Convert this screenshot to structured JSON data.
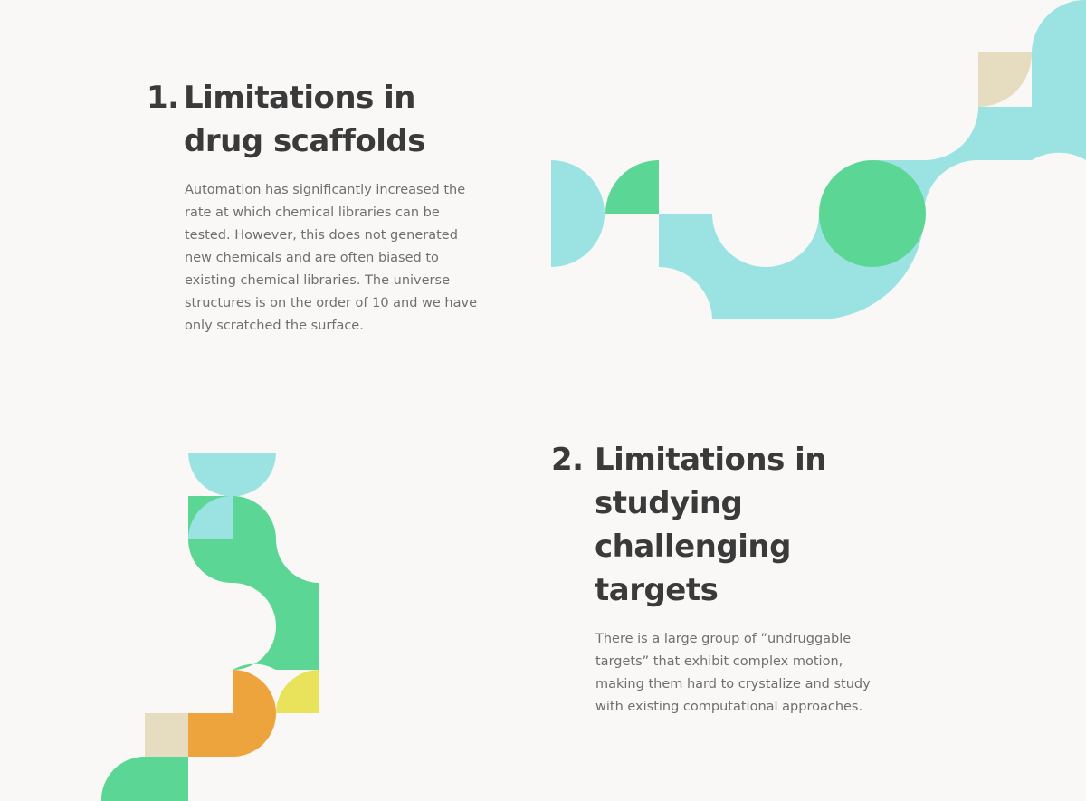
{
  "section1": {
    "number": "1.",
    "title_lines": [
      "Limitations in",
      "drug scaffolds"
    ],
    "body_lines": [
      "Automation has significantly increased the",
      "rate at which chemical libraries can be",
      "tested. However, this does not generated",
      "new chemicals and are often biased to",
      "existing chemical libraries. The universe",
      "structures is on the order of 10 and we have",
      "only scratched the surface."
    ]
  },
  "section2": {
    "number": "2.",
    "title_lines": [
      "Limitations in",
      "studying",
      "challenging",
      "targets"
    ],
    "body_lines": [
      "There is a large group of ”undruggable",
      "targets” that exhibit complex motion,",
      "making them hard to crystalize and study",
      "with existing computational approaches."
    ]
  },
  "colors": {
    "background": "#f9f8f6",
    "heading": "#3a3a3a",
    "body": "#6f6f6f",
    "aqua": "#9be3e2",
    "green": "#5cd695",
    "beige": "#e6dcc0",
    "orange": "#eea43c",
    "yellow": "#e8e35a"
  }
}
